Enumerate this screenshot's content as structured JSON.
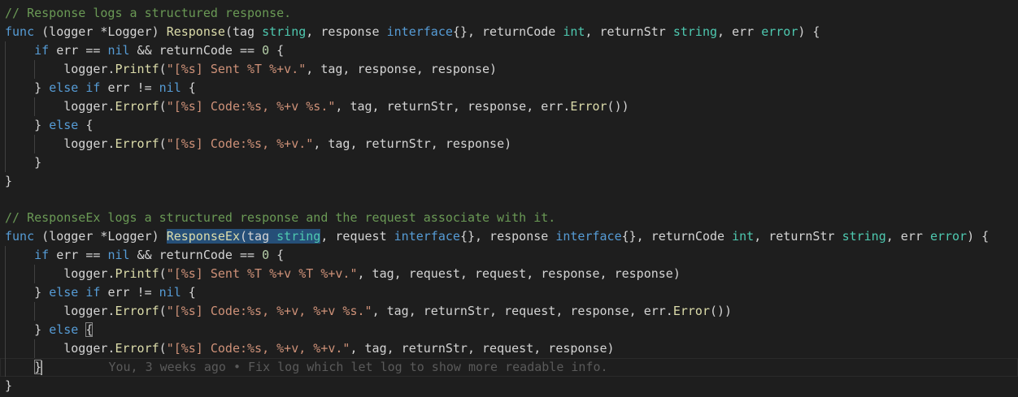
{
  "editor": {
    "tokens": {
      "c1": "// Response logs a structured response.",
      "func": "func",
      "recv": "(logger *Logger) ",
      "response_fn": "Response",
      "p_open_tag": "(tag ",
      "string": "string",
      "p_response": ", response ",
      "interface": "interface",
      "p_braces_ret": "{}, returnCode ",
      "int": "int",
      "p_retstr": ", returnStr ",
      "p_err": ", err ",
      "error": "error",
      "p_close": ") {",
      "if": "if",
      "err_eq": "err == ",
      "nil": "nil",
      "and_rc": " && returnCode == ",
      "zero": "0",
      "open_brace": " {",
      "logger_dot": "logger.",
      "printf": "Printf",
      "errorf": "Errorf",
      "lparen": "(",
      "s1": "\"[%s] Sent %T %+v.\"",
      "a1": ", tag, response, response)",
      "close_else": "} ",
      "else": "else",
      "err_ne": "err != ",
      "s2": "\"[%s] Code:%s, %+v %s.\"",
      "a2": ", tag, returnStr, response, err.",
      "error_method": "Error",
      "a2_end": "())",
      "s3": "\"[%s] Code:%s, %+v.\"",
      "a3": ", tag, returnStr, response)",
      "close": "}",
      "c2": "// ResponseEx logs a structured response and the request associate with it.",
      "responseex_fn": "ResponseEx",
      "p_request": ", request ",
      "p_braces_resp": "{}, response ",
      "s4": "\"[%s] Sent %T %+v %T %+v.\"",
      "a4": ", tag, request, request, response, response)",
      "s5": "\"[%s] Code:%s, %+v, %+v %s.\"",
      "a5": ", tag, returnStr, request, response, err.",
      "s6": "\"[%s] Code:%s, %+v, %+v.\"",
      "a6": ", tag, returnStr, request, response)",
      "blame": "You, 3 weeks ago • Fix log which let log to show more readable info."
    }
  }
}
